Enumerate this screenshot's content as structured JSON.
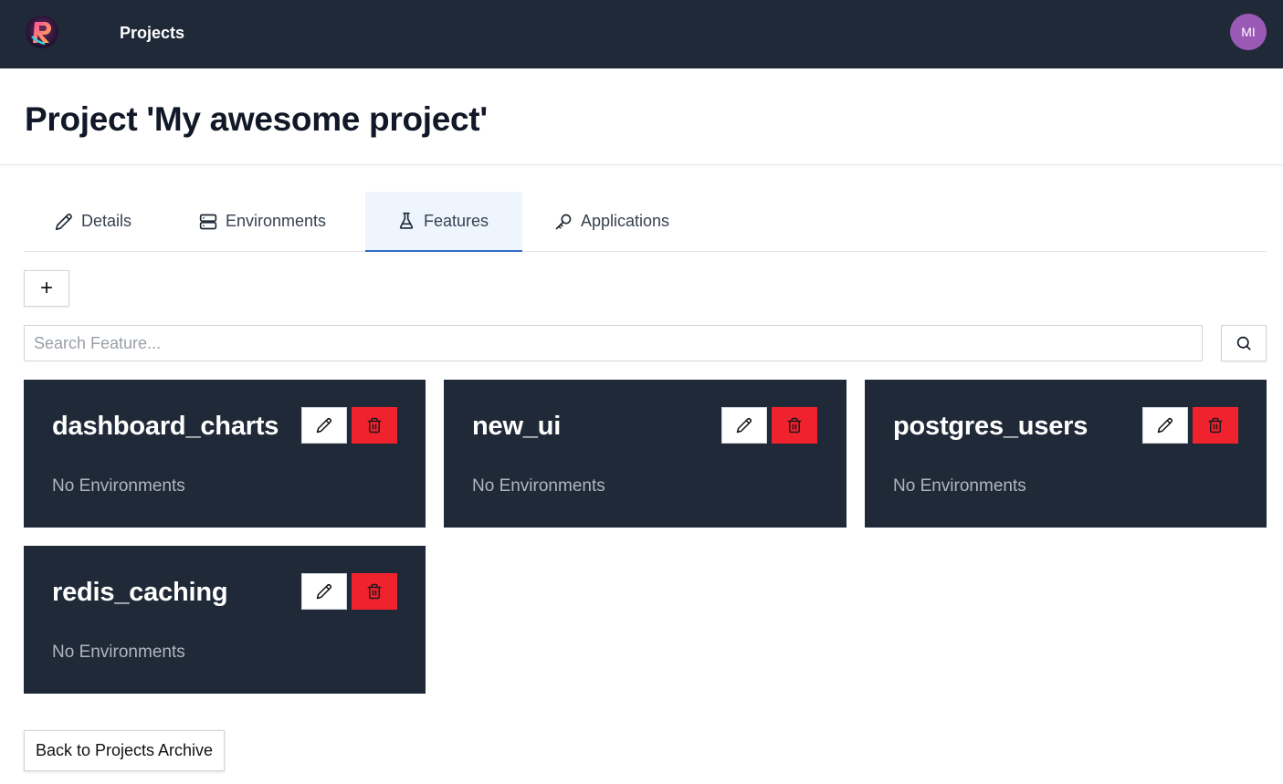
{
  "header": {
    "logo_letter": "R",
    "nav_projects": "Projects",
    "avatar_initials": "MI",
    "avatar_color": "#9b59b6"
  },
  "page": {
    "title": "Project 'My awesome project'"
  },
  "tabs": [
    {
      "label": "Details",
      "icon": "pencil-icon",
      "active": false
    },
    {
      "label": "Environments",
      "icon": "server-icon",
      "active": false
    },
    {
      "label": "Features",
      "icon": "flask-icon",
      "active": true
    },
    {
      "label": "Applications",
      "icon": "key-icon",
      "active": false
    }
  ],
  "toolbar": {
    "add_label": "+",
    "search_placeholder": "Search Feature...",
    "search_value": ""
  },
  "features": [
    {
      "name": "dashboard_charts",
      "environments": "No Environments"
    },
    {
      "name": "new_ui",
      "environments": "No Environments"
    },
    {
      "name": "postgres_users",
      "environments": "No Environments"
    },
    {
      "name": "redis_caching",
      "environments": "No Environments"
    }
  ],
  "footer": {
    "back_label": "Back to Projects Archive"
  },
  "colors": {
    "topbar": "#1f2937",
    "card_bg": "#1f2937",
    "danger": "#f0222e",
    "active_tab_bg": "#eef5fd",
    "active_tab_border": "#2f6fc6"
  }
}
